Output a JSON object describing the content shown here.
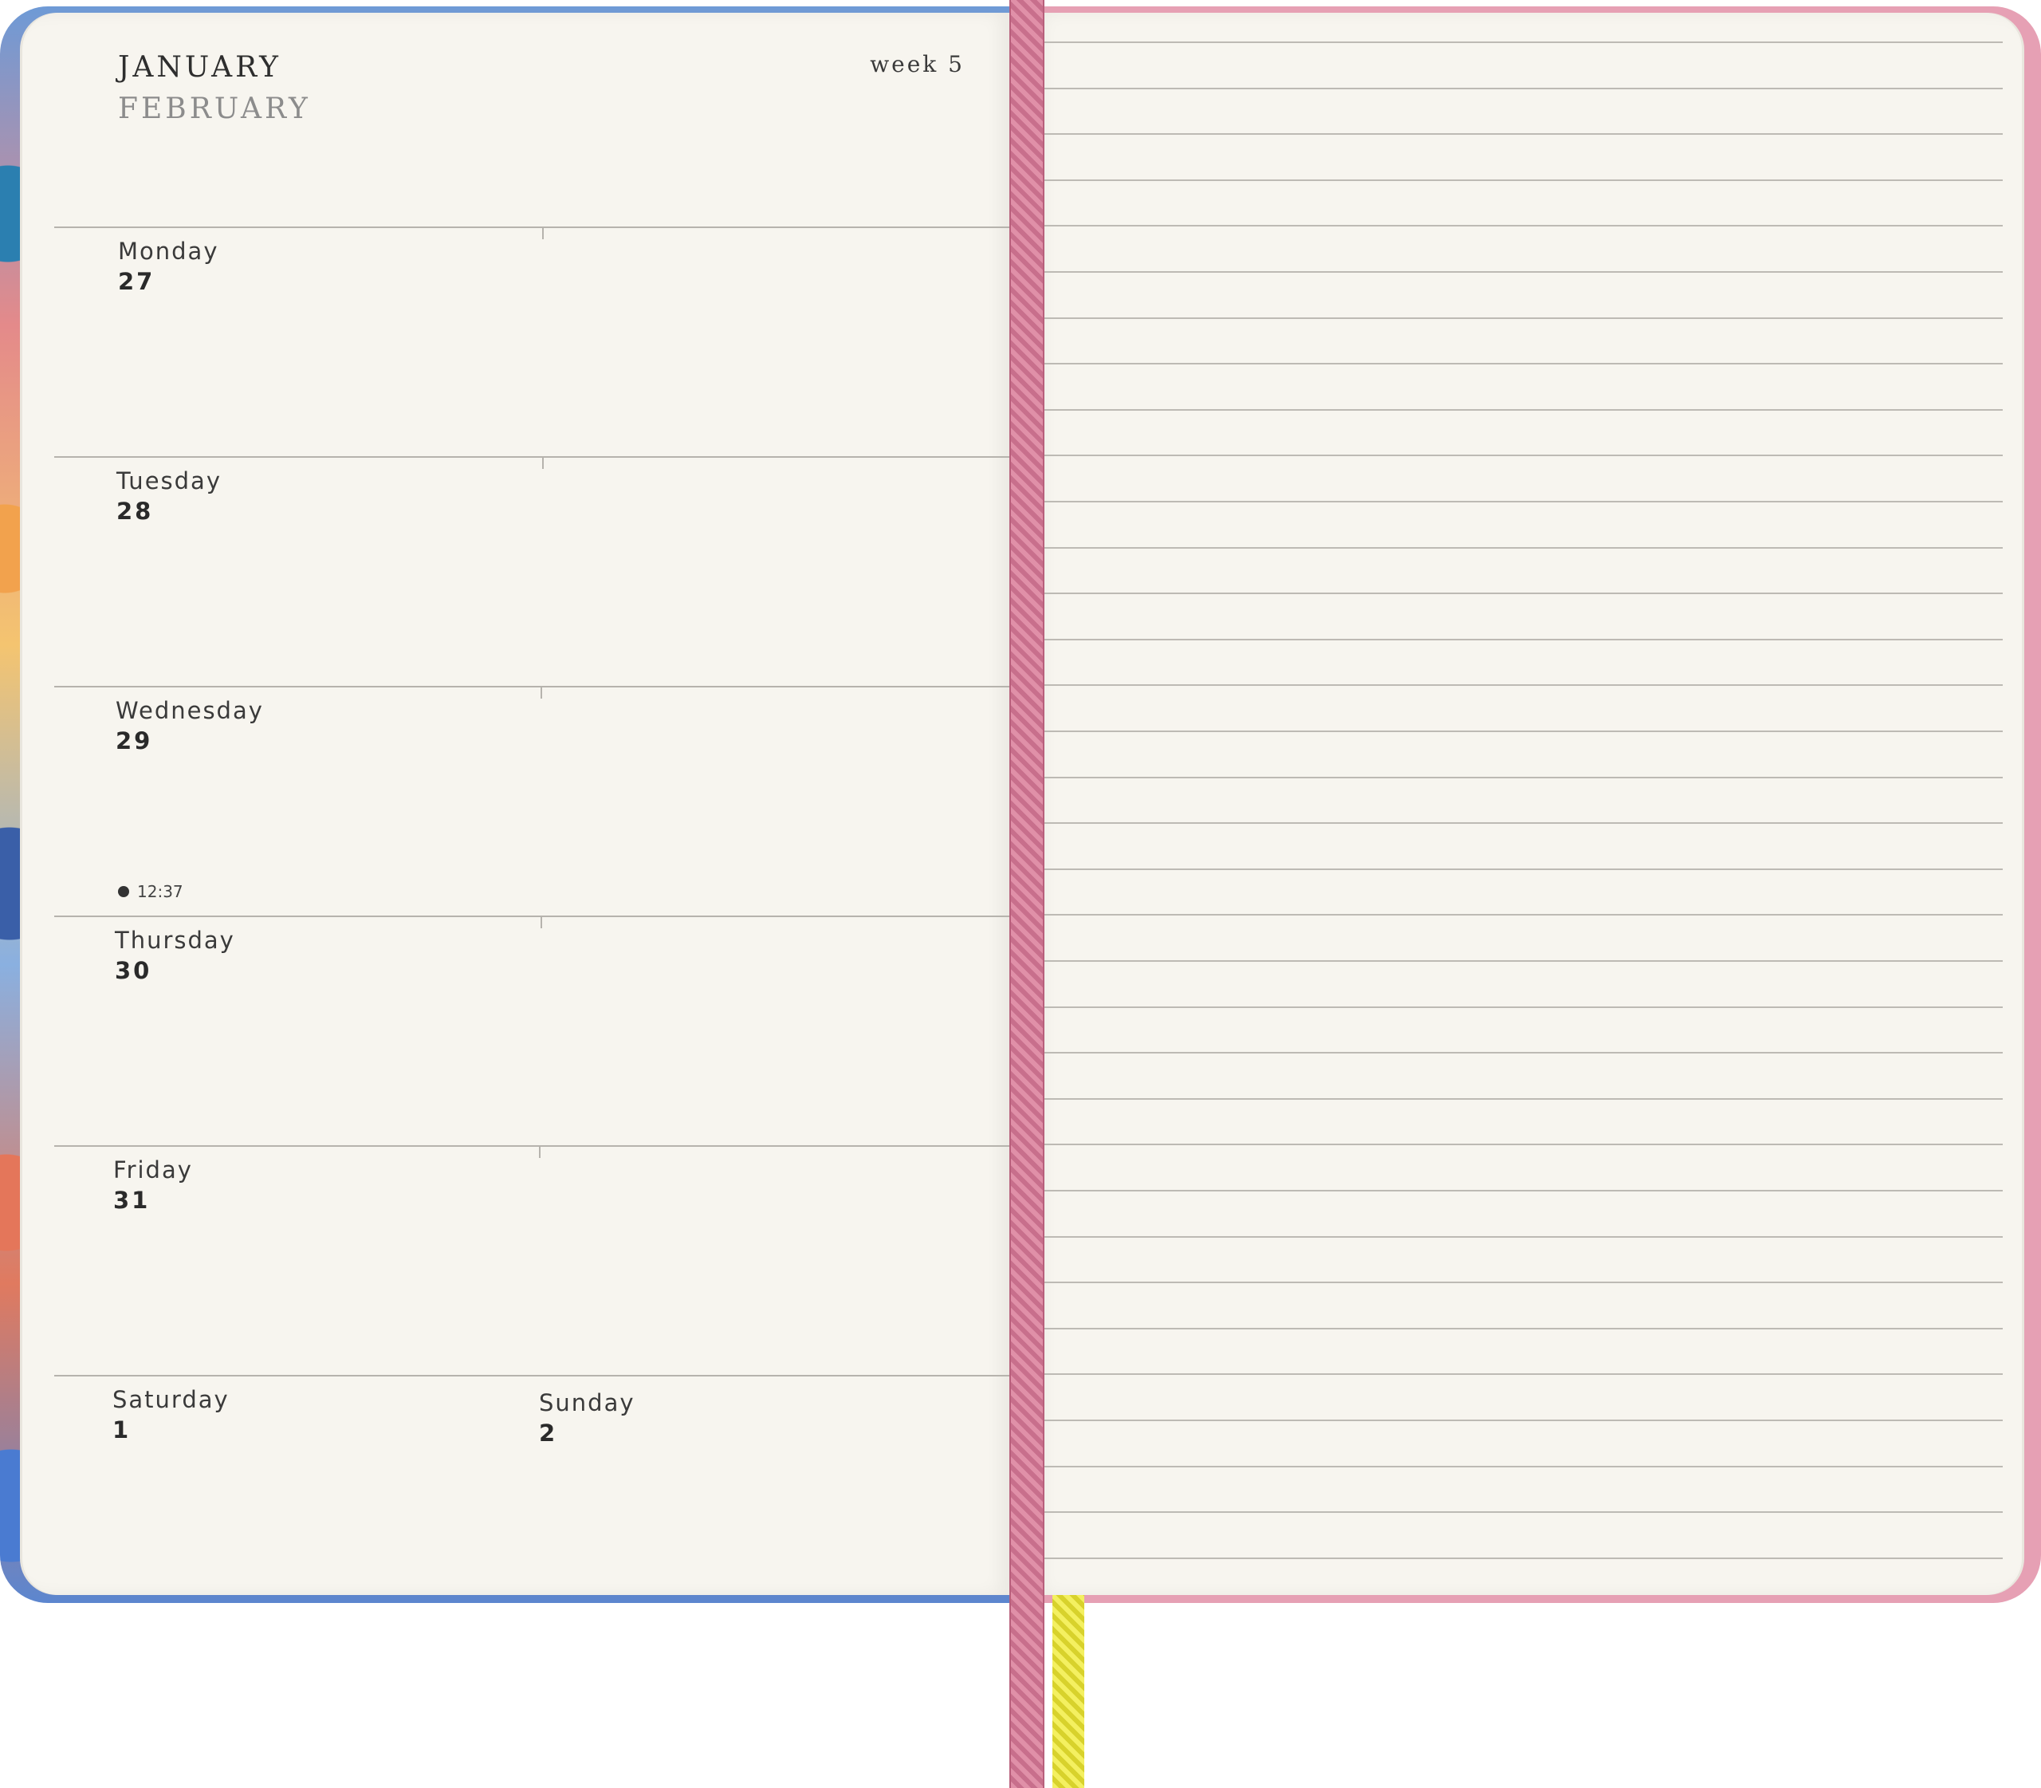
{
  "planner": {
    "header": {
      "month_primary": "JANUARY",
      "month_secondary": "FEBRUARY",
      "week": "week 5"
    },
    "days": [
      {
        "name": "Monday",
        "date": "27"
      },
      {
        "name": "Tuesday",
        "date": "28"
      },
      {
        "name": "Wednesday",
        "date": "29"
      },
      {
        "name": "Thursday",
        "date": "30"
      },
      {
        "name": "Friday",
        "date": "31"
      },
      {
        "name": "Saturday",
        "date": "1"
      },
      {
        "name": "Sunday",
        "date": "2"
      }
    ],
    "moon_phase": {
      "icon": "new-moon-icon",
      "time": "12:37"
    }
  },
  "colors": {
    "cover_pink": "#e6a0b4",
    "page": "#f7f5ef",
    "ribbon_pink": "#d9859e",
    "ribbon_yellow": "#e8e440"
  }
}
